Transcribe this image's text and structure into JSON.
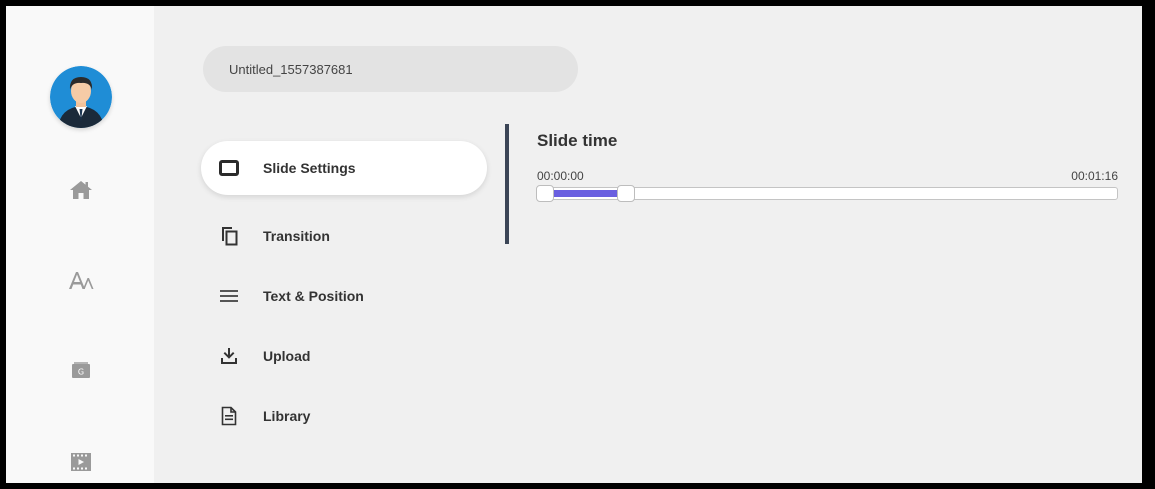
{
  "document": {
    "title": "Untitled_1557387681"
  },
  "sidebar": {
    "icons": [
      {
        "name": "home-icon"
      },
      {
        "name": "text-font-icon"
      },
      {
        "name": "gallery-icon"
      },
      {
        "name": "video-icon"
      }
    ]
  },
  "menu": {
    "items": [
      {
        "label": "Slide Settings",
        "icon": "slide-icon",
        "active": true
      },
      {
        "label": "Transition",
        "icon": "copy-icon",
        "active": false
      },
      {
        "label": "Text & Position",
        "icon": "lines-icon",
        "active": false
      },
      {
        "label": "Upload",
        "icon": "upload-icon",
        "active": false
      },
      {
        "label": "Library",
        "icon": "document-icon",
        "active": false
      }
    ]
  },
  "slide_time": {
    "title": "Slide time",
    "start_label": "00:00:00",
    "end_label": "00:01:16",
    "range_start_fraction": 0.0,
    "range_end_fraction": 0.14
  },
  "colors": {
    "accent": "#6a5fe0",
    "divider": "#3b4556",
    "background": "#f0f0f0",
    "rail": "#f9f9f9"
  }
}
